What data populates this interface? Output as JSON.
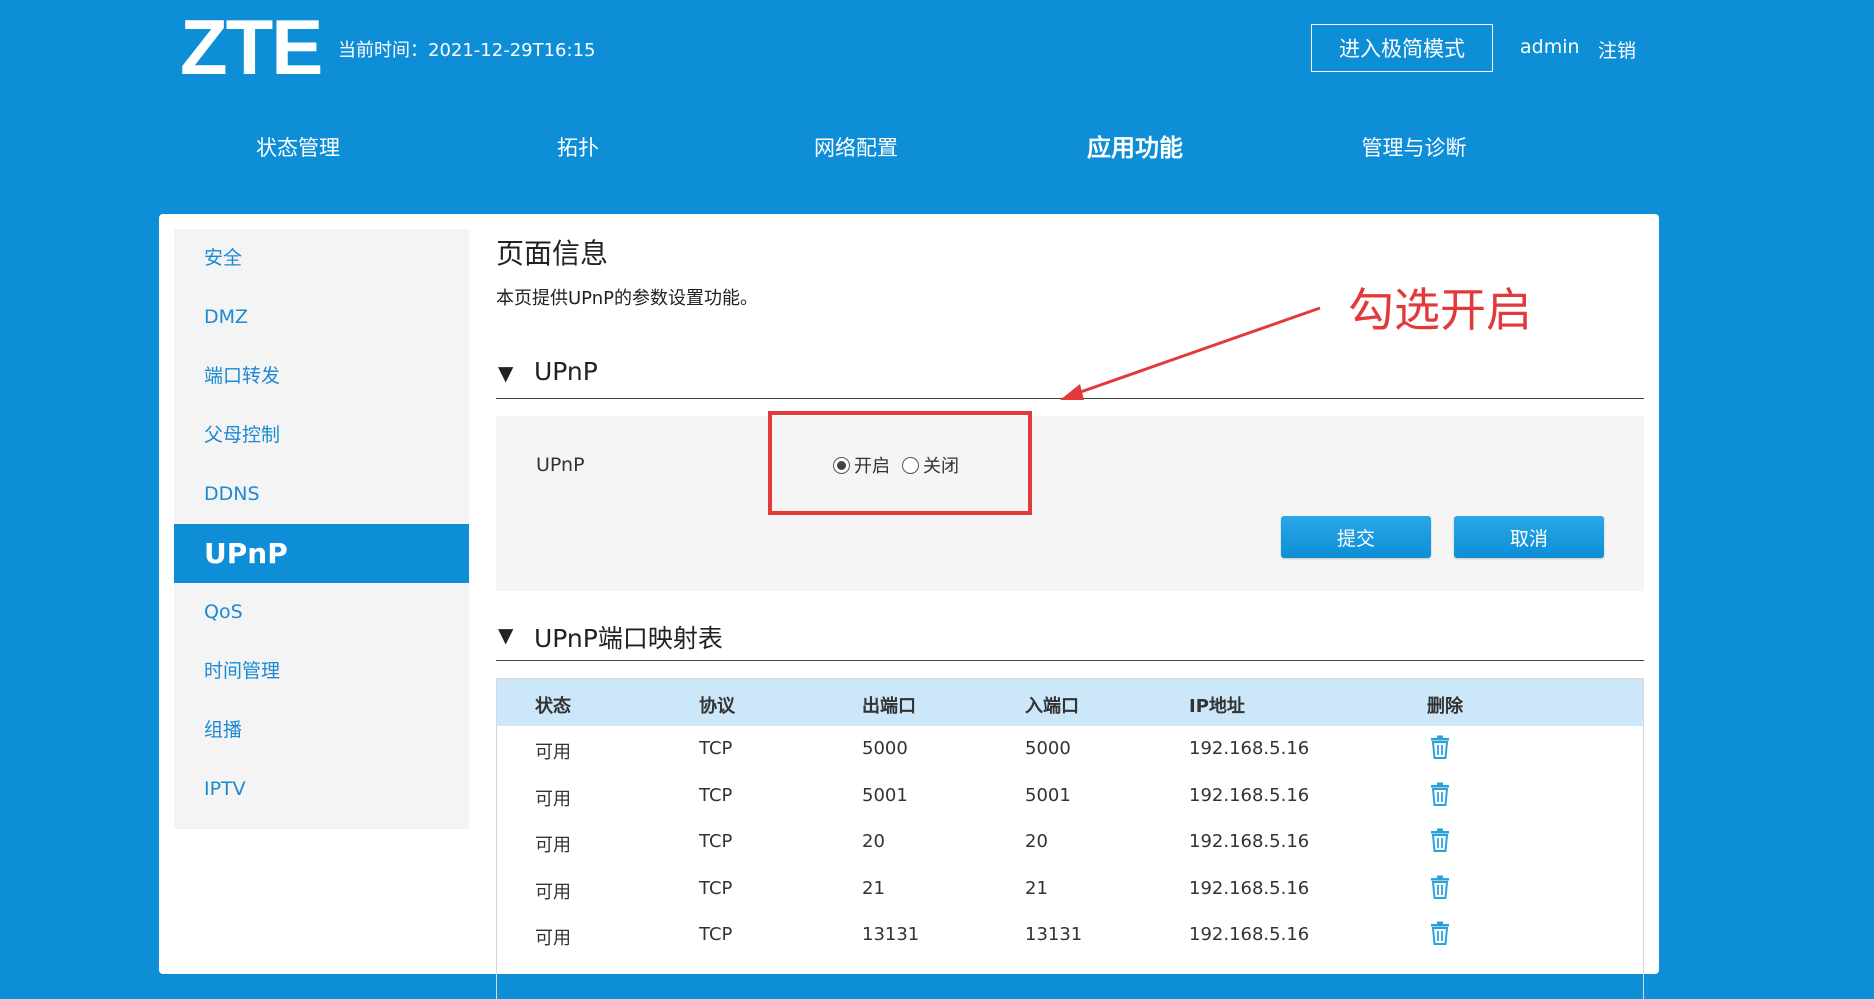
{
  "header": {
    "logo": "ZTE",
    "time_label": "当前时间：2021-12-29T16:15",
    "simple_mode_button": "进入极简模式",
    "username": "admin",
    "logout": "注销"
  },
  "main_nav": [
    {
      "label": "状态管理",
      "active": false
    },
    {
      "label": "拓扑",
      "active": false
    },
    {
      "label": "网络配置",
      "active": false
    },
    {
      "label": "应用功能",
      "active": true
    },
    {
      "label": "管理与诊断",
      "active": false
    }
  ],
  "sidebar": {
    "items": [
      {
        "label": "安全"
      },
      {
        "label": "DMZ"
      },
      {
        "label": "端口转发"
      },
      {
        "label": "父母控制"
      },
      {
        "label": "DDNS"
      },
      {
        "label": "UPnP",
        "active": true
      },
      {
        "label": "QoS"
      },
      {
        "label": "时间管理"
      },
      {
        "label": "组播"
      },
      {
        "label": "IPTV"
      }
    ]
  },
  "page": {
    "title": "页面信息",
    "description": "本页提供UPnP的参数设置功能。"
  },
  "upnp_section": {
    "title": "UPnP",
    "field_label": "UPnP",
    "options": [
      {
        "label": "开启",
        "checked": true
      },
      {
        "label": "关闭",
        "checked": false
      }
    ],
    "submit": "提交",
    "cancel": "取消"
  },
  "mapping_section": {
    "title": "UPnP端口映射表",
    "columns": [
      "状态",
      "协议",
      "出端口",
      "入端口",
      "IP地址",
      "删除"
    ],
    "rows": [
      {
        "status": "可用",
        "protocol": "TCP",
        "out_port": "5000",
        "in_port": "5000",
        "ip": "192.168.5.16"
      },
      {
        "status": "可用",
        "protocol": "TCP",
        "out_port": "5001",
        "in_port": "5001",
        "ip": "192.168.5.16"
      },
      {
        "status": "可用",
        "protocol": "TCP",
        "out_port": "20",
        "in_port": "20",
        "ip": "192.168.5.16"
      },
      {
        "status": "可用",
        "protocol": "TCP",
        "out_port": "21",
        "in_port": "21",
        "ip": "192.168.5.16"
      },
      {
        "status": "可用",
        "protocol": "TCP",
        "out_port": "13131",
        "in_port": "13131",
        "ip": "192.168.5.16"
      }
    ]
  },
  "annotation": {
    "text": "勾选开启",
    "color": "#e23a3a"
  },
  "colors": {
    "brand_blue": "#0d8ed6",
    "table_header": "#cce6fa",
    "link": "#1c8ad3"
  },
  "icons": {
    "delete": "trash-icon",
    "collapse": "triangle-down-icon"
  }
}
